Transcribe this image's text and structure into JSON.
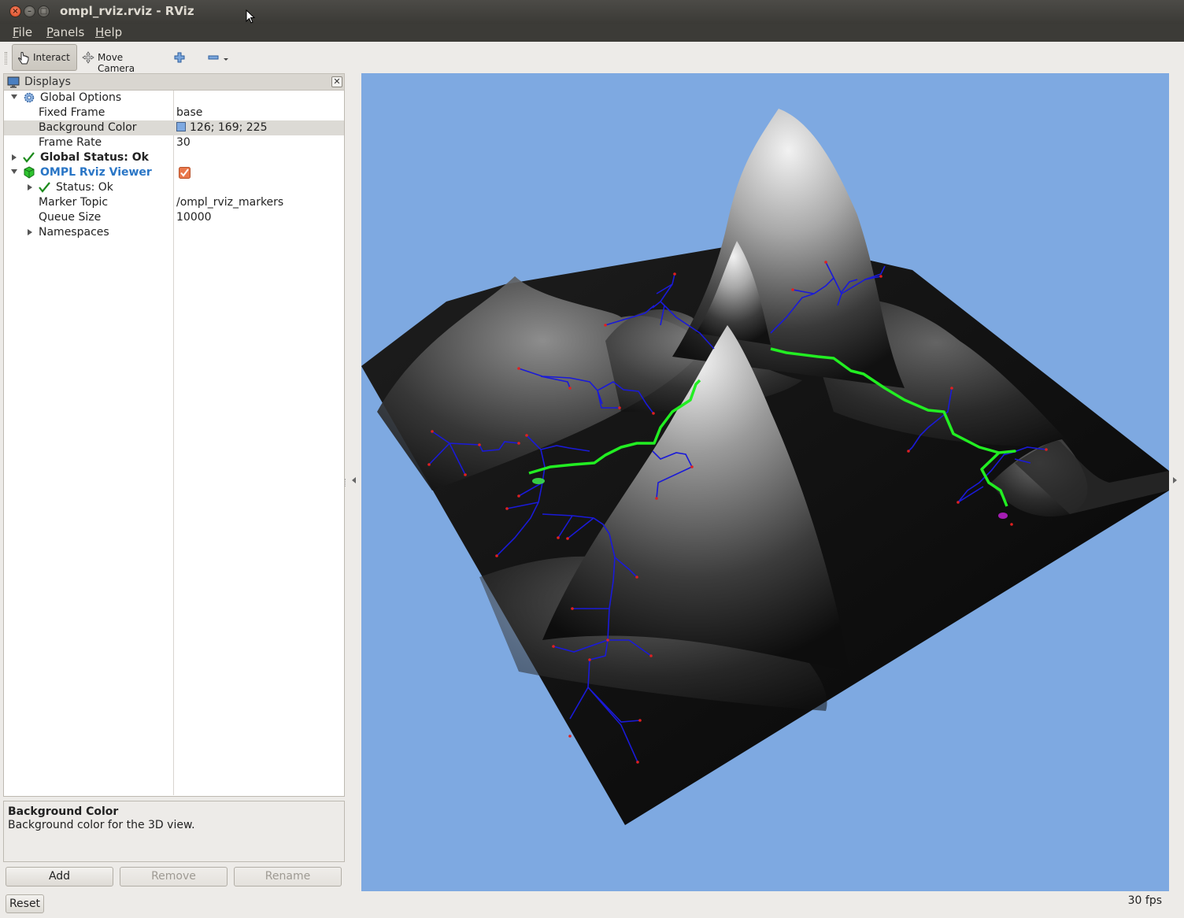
{
  "window": {
    "title": "ompl_rviz.rviz - RViz"
  },
  "menu": {
    "file": "File",
    "file_mn": "F",
    "file_rest": "ile",
    "panels_mn": "P",
    "panels_rest": "anels",
    "help_mn": "H",
    "help_rest": "elp"
  },
  "toolbar": {
    "interact": "Interact",
    "move_camera": "Move Camera"
  },
  "displays": {
    "title": "Displays",
    "close": "✕",
    "rows": {
      "global_options": "Global Options",
      "fixed_frame": {
        "name": "Fixed Frame",
        "value": "base"
      },
      "background_color": {
        "name": "Background Color",
        "value": "126; 169; 225"
      },
      "frame_rate": {
        "name": "Frame Rate",
        "value": "30"
      },
      "global_status": "Global Status: Ok",
      "ompl_viewer": "OMPL Rviz Viewer",
      "status": "Status: Ok",
      "marker_topic": {
        "name": "Marker Topic",
        "value": "/ompl_rviz_markers"
      },
      "queue_size": {
        "name": "Queue Size",
        "value": "10000"
      },
      "namespaces": "Namespaces"
    },
    "help": {
      "title": "Background Color",
      "text": "Background color for the 3D view."
    },
    "buttons": {
      "add": "Add",
      "remove": "Remove",
      "rename": "Rename"
    }
  },
  "view3d": {
    "background_color": "#7ea9e1",
    "path_color": "#22ee22",
    "tree_color": "#1a1ad8",
    "node_color": "#e02020"
  },
  "status": {
    "reset": "Reset",
    "fps": "30 fps"
  }
}
